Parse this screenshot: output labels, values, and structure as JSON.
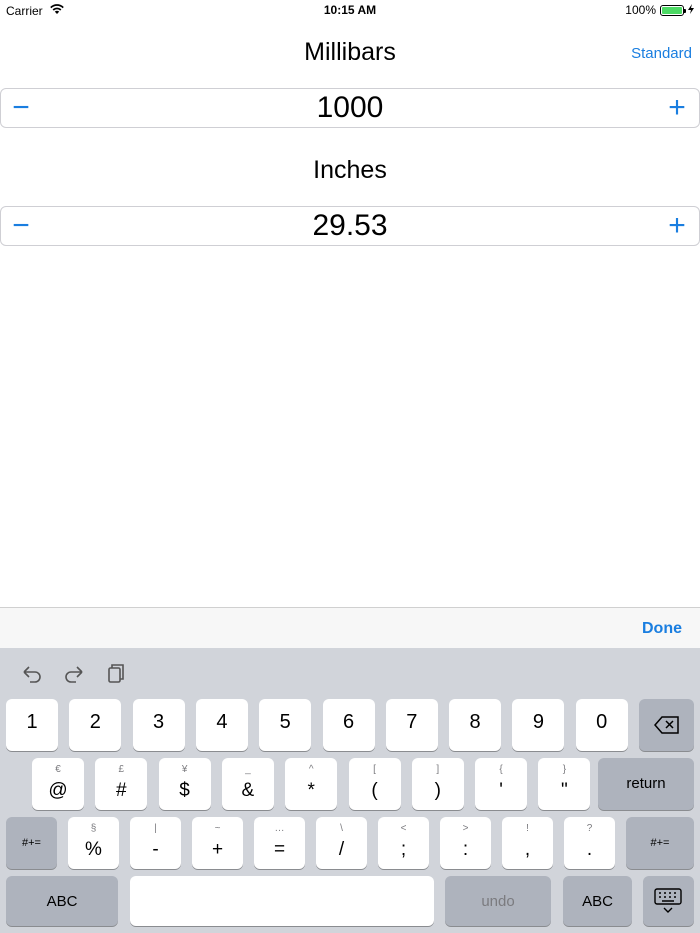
{
  "status_bar": {
    "carrier": "Carrier",
    "time": "10:15 AM",
    "battery": "100%",
    "battery_level": 1.0
  },
  "nav": {
    "title": "Millibars",
    "action_label": "Standard"
  },
  "millibars": {
    "minus_label": "−",
    "value": "1000",
    "plus_label": "+"
  },
  "inches": {
    "label": "Inches",
    "minus_label": "−",
    "value": "29.53",
    "plus_label": "+"
  },
  "accessory": {
    "done_label": "Done"
  },
  "keyboard": {
    "row1": [
      "1",
      "2",
      "3",
      "4",
      "5",
      "6",
      "7",
      "8",
      "9",
      "0"
    ],
    "row2": [
      {
        "main": "@",
        "sub": "€"
      },
      {
        "main": "#",
        "sub": "£"
      },
      {
        "main": "$",
        "sub": "¥"
      },
      {
        "main": "&",
        "sub": "_"
      },
      {
        "main": "*",
        "sub": "^"
      },
      {
        "main": "(",
        "sub": "["
      },
      {
        "main": ")",
        "sub": "]"
      },
      {
        "main": "'",
        "sub": "{"
      },
      {
        "main": "\"",
        "sub": "}"
      }
    ],
    "return_label": "return",
    "symbols_label": "#+=",
    "row3": [
      {
        "main": "%",
        "sub": "§"
      },
      {
        "main": "-",
        "sub": "|"
      },
      {
        "main": "+",
        "sub": "~"
      },
      {
        "main": "=",
        "sub": "…"
      },
      {
        "main": "/",
        "sub": "\\"
      },
      {
        "main": ";",
        "sub": "<"
      },
      {
        "main": ":",
        "sub": ">"
      },
      {
        "main": ",",
        "sub": "!"
      },
      {
        "main": ".",
        "sub": "?"
      }
    ],
    "abc_label": "ABC",
    "undo_label": "undo"
  }
}
